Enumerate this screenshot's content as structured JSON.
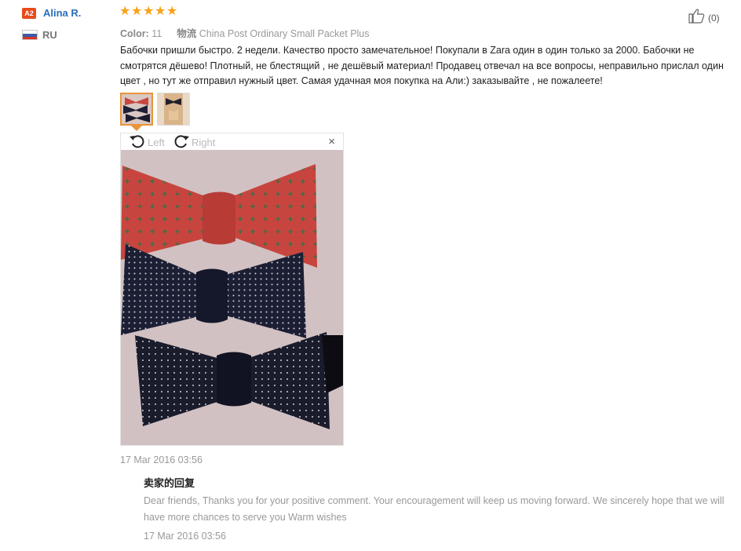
{
  "reviewer": {
    "badge": "A2",
    "name": "Alina R.",
    "country": "RU"
  },
  "rating": {
    "stars": 5,
    "max": 5
  },
  "helpful": {
    "count": "(0)"
  },
  "meta": {
    "color_label": "Color:",
    "color_value": "11",
    "logistics_label": "物流",
    "logistics_value": "China Post Ordinary Small Packet Plus"
  },
  "review_text": "Бабочки пришли быстро. 2 недели. Качество просто замечательное! Покупали в Zara один в один только за 2000. Бабочки не смотрятся дёшево! Плотный, не блестящий , не дешёвый материал! Продавец отвечал на все вопросы, неправильно прислал один цвет , но тут же отправил нужный цвет. Самая удачная моя покупка на Али:) заказывайте , не пожалеете!",
  "viewer": {
    "rotate_left": "Left",
    "rotate_right": "Right",
    "close": "×"
  },
  "review_date": "17 Mar 2016 03:56",
  "seller_reply": {
    "title": "卖家的回复",
    "text": "Dear friends, Thanks you for your positive comment. Your encouragement will keep us moving forward. We sincerely hope that we will have more chances to serve you Warm wishes",
    "date": "17 Mar 2016 03:56"
  },
  "colors": {
    "accent": "#e9943a",
    "name_link": "#2a6ebb",
    "star": "#f6a21a",
    "badge": "#e74b1c"
  },
  "icons": [
    "thumbs-up-icon",
    "rotate-left-icon",
    "rotate-right-icon",
    "close-icon",
    "star-icon",
    "flag-icon"
  ]
}
